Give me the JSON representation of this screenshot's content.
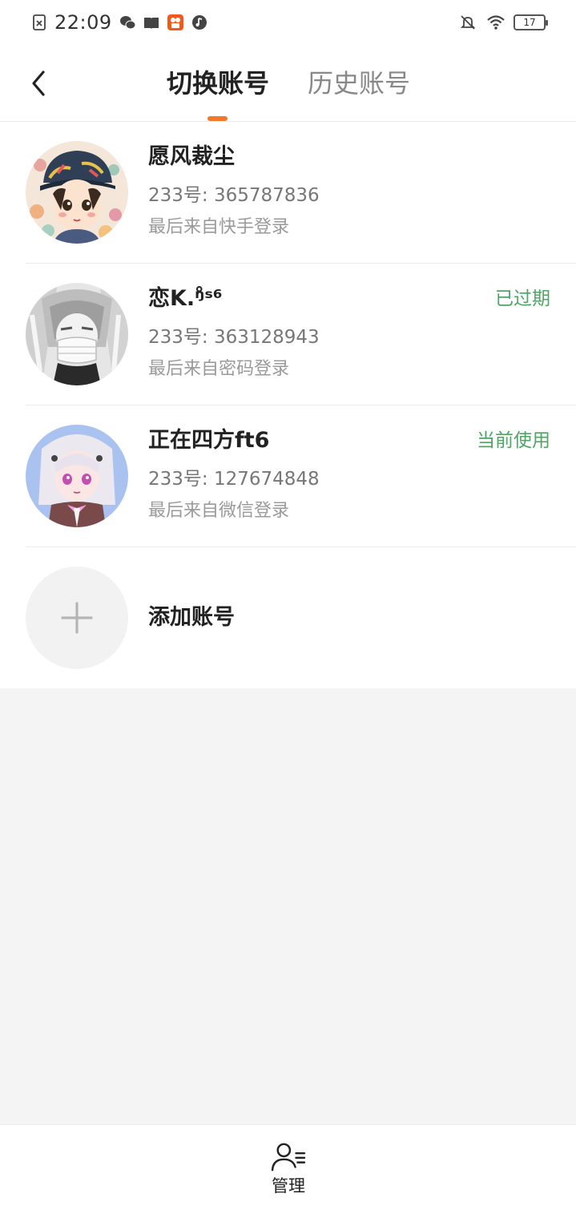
{
  "status_bar": {
    "time": "22:09",
    "battery_level": "17",
    "icons": [
      "sim-error-icon",
      "wechat-icon",
      "book-icon",
      "app-badge-icon",
      "music-icon",
      "bell-muted-icon",
      "wifi-icon",
      "battery-icon"
    ]
  },
  "header": {
    "back_icon": "chevron-left-icon",
    "tabs": [
      {
        "label": "切换账号",
        "active": true
      },
      {
        "label": "历史账号",
        "active": false
      }
    ],
    "accent_color": "#f07a2a"
  },
  "accounts": [
    {
      "name": "愿风裁尘",
      "id_text": "233号: 365787836",
      "login_source": "最后来自快手登录",
      "status": ""
    },
    {
      "name": "恋K.ᵑ̊ˢ⁶",
      "id_text": "233号: 363128943",
      "login_source": "最后来自密码登录",
      "status": "已过期"
    },
    {
      "name": "正在四方ft6",
      "id_text": "233号: 127674848",
      "login_source": "最后来自微信登录",
      "status": "当前使用"
    }
  ],
  "add_account": {
    "label": "添加账号",
    "icon": "plus-icon"
  },
  "bottom_bar": {
    "manage_label": "管理",
    "manage_icon": "user-list-icon"
  },
  "colors": {
    "status_green": "#4ea564",
    "background": "#f4f4f4"
  }
}
